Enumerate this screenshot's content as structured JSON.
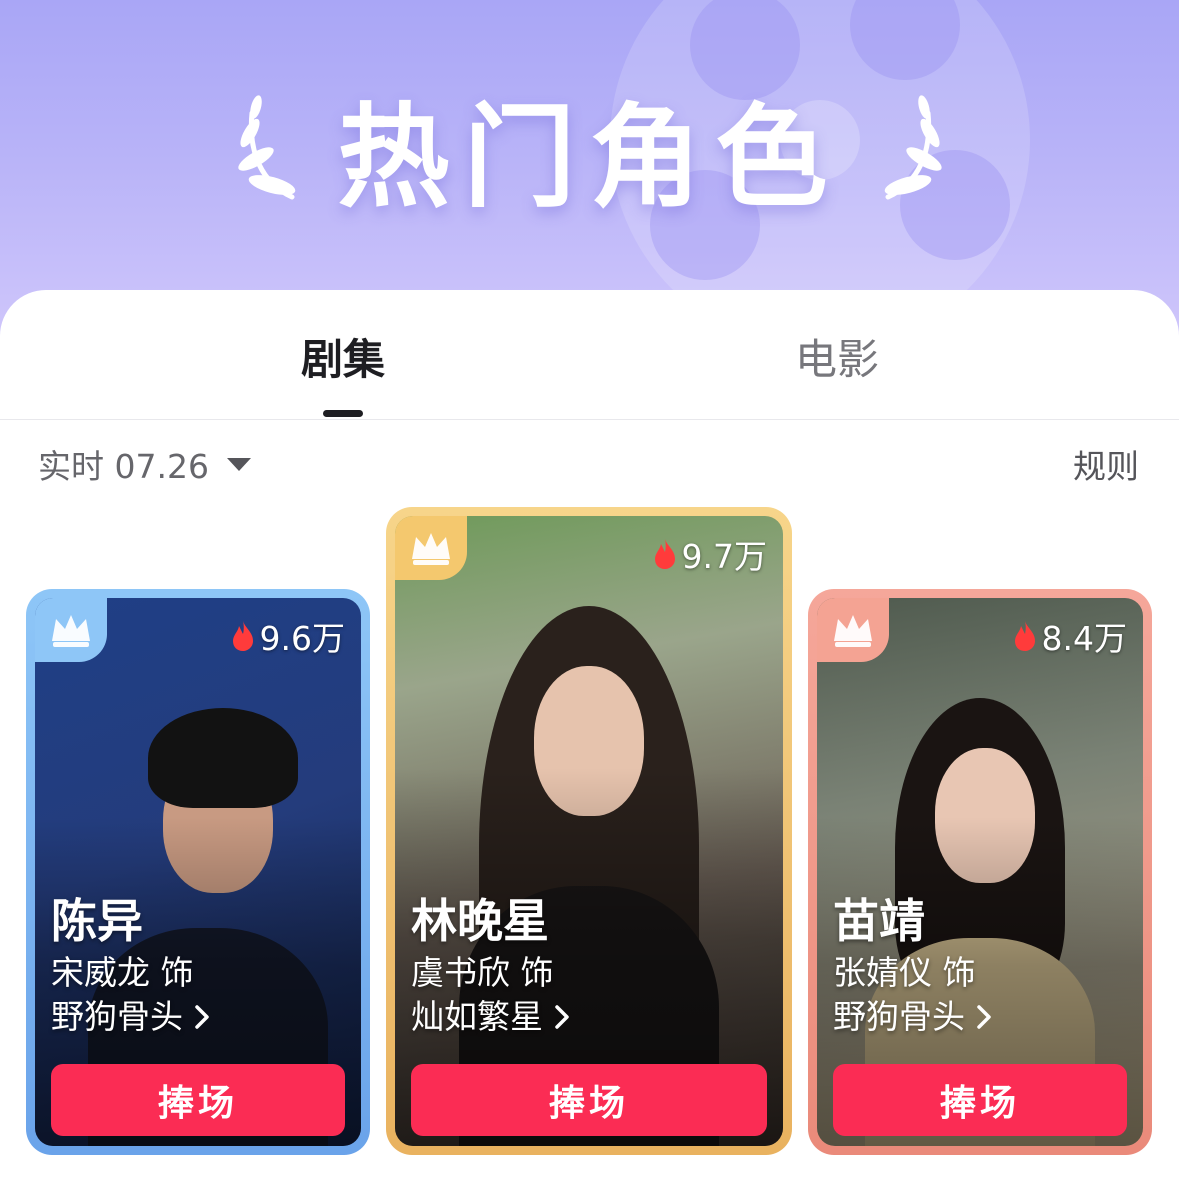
{
  "header": {
    "title": "热门角色",
    "colors": {
      "banner_top": "#a9a6f6",
      "banner_bottom": "#cfc6fb"
    }
  },
  "tabs": [
    {
      "label": "剧集",
      "active": true
    },
    {
      "label": "电影",
      "active": false
    }
  ],
  "filter": {
    "date_label": "实时 07.26",
    "rules_label": "规则"
  },
  "cards": [
    {
      "rank": 2,
      "heat": "9.6万",
      "character": "陈异",
      "actor": "宋威龙 饰",
      "drama": "野狗骨头",
      "button": "捧场",
      "frame_color": "#8ec6f7"
    },
    {
      "rank": 1,
      "heat": "9.7万",
      "character": "林晚星",
      "actor": "虞书欣 饰",
      "drama": "灿如繁星",
      "button": "捧场",
      "frame_color": "#f4c86e"
    },
    {
      "rank": 3,
      "heat": "8.4万",
      "character": "苗靖",
      "actor": "张婧仪 饰",
      "drama": "野狗骨头",
      "button": "捧场",
      "frame_color": "#f4a393"
    }
  ],
  "accent_color": "#fb2c54",
  "icons": [
    "laurel-left-icon",
    "laurel-right-icon",
    "crown-icon",
    "flame-icon",
    "caret-down-icon",
    "chevron-right-icon"
  ]
}
